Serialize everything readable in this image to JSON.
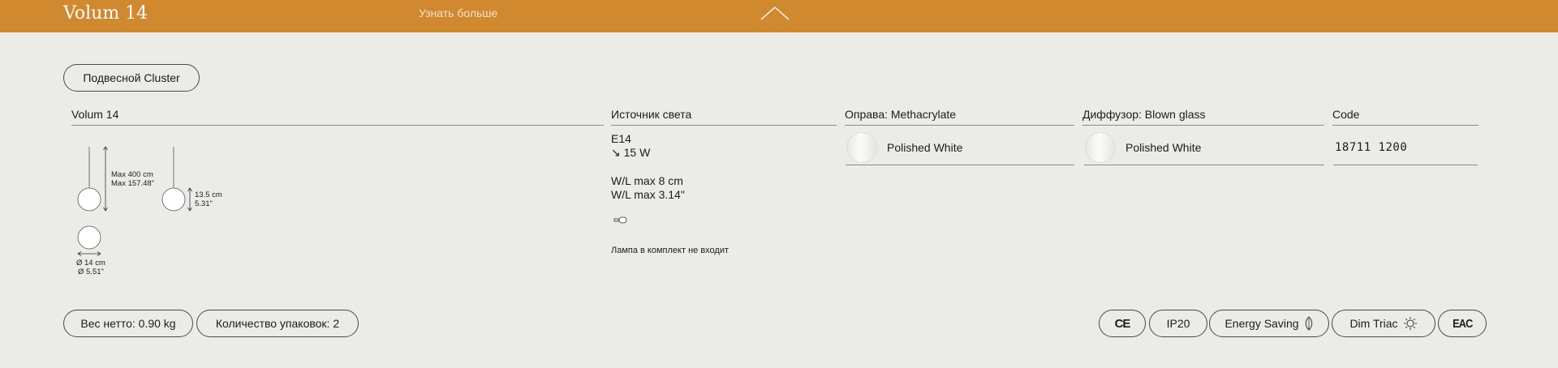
{
  "header": {
    "product_name": "Volum 14",
    "learn_more": "Узнать больше"
  },
  "category_pill": "Подвесной Cluster",
  "columns": {
    "product": "Volum 14",
    "light_source": "Источник света",
    "frame": "Оправа: Methacrylate",
    "diffuser": "Диффузор: Blown glass",
    "code": "Code"
  },
  "light_source": {
    "socket": "E14",
    "power": "↘ 15 W",
    "wl_cm": "W/L max 8 cm",
    "wl_in": "W/L max 3.14\"",
    "bulb_note": "Лампа в комплект не входит"
  },
  "frame_finish": "Polished White",
  "diffuser_finish": "Polished White",
  "code_value": "18711  1200",
  "diagram": {
    "max_cm": "Max 400 cm",
    "max_in": "Max 157.48\"",
    "height_cm": "13.5 cm",
    "height_in": "5.31\"",
    "dia_cm": "Ø 14 cm",
    "dia_in": "Ø 5.51\""
  },
  "footer": {
    "net_weight": "Вес нетто: 0.90 kg",
    "packages": "Количество упаковок: 2",
    "badges": {
      "ce": "CE",
      "ip": "IP20",
      "energy": "Energy Saving",
      "dim": "Dim Triac",
      "eac": "EAC"
    }
  },
  "colors": {
    "accent": "#d1892f",
    "background": "#ebebe7"
  }
}
